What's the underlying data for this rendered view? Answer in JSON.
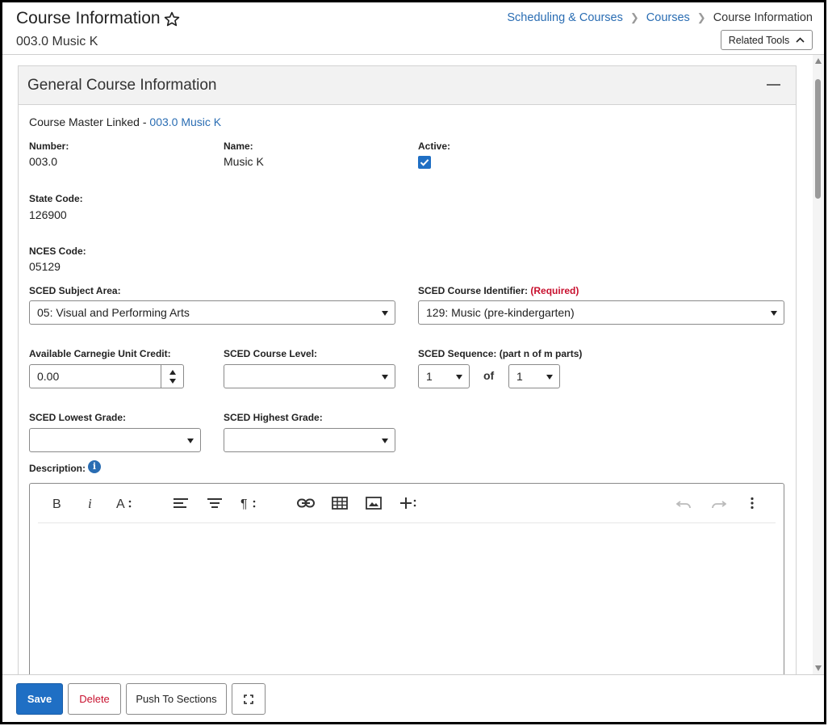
{
  "header": {
    "title": "Course Information",
    "subtitle": "003.0 Music K",
    "related_tools_label": "Related Tools"
  },
  "breadcrumb": [
    {
      "label": "Scheduling & Courses"
    },
    {
      "label": "Courses"
    },
    {
      "label": "Course Information"
    }
  ],
  "panel": {
    "title": "General Course Information",
    "master_linked_prefix": "Course Master Linked - ",
    "master_linked_link": "003.0 Music K"
  },
  "fields": {
    "number_label": "Number:",
    "number_value": "003.0",
    "name_label": "Name:",
    "name_value": "Music K",
    "active_label": "Active:",
    "active_checked": true,
    "state_code_label": "State Code:",
    "state_code_value": "126900",
    "nces_code_label": "NCES Code:",
    "nces_code_value": "05129",
    "sced_subject_label": "SCED Subject Area:",
    "sced_subject_value": "05: Visual and Performing Arts",
    "sced_course_id_label": "SCED Course Identifier:",
    "sced_course_id_required": "(Required)",
    "sced_course_id_value": "129: Music (pre-kindergarten)",
    "carnegie_label": "Available Carnegie Unit Credit:",
    "carnegie_value": "0.00",
    "course_level_label": "SCED Course Level:",
    "course_level_value": "",
    "sequence_label": "SCED Sequence: (part n of m parts)",
    "sequence_n_value": "1",
    "sequence_of": "of",
    "sequence_m_value": "1",
    "lowest_grade_label": "SCED Lowest Grade:",
    "lowest_grade_value": "",
    "highest_grade_label": "SCED Highest Grade:",
    "highest_grade_value": "",
    "description_label": "Description:"
  },
  "editor_toolbar": {
    "icons": [
      "bold-icon",
      "italic-icon",
      "font-size-icon",
      "align-left-icon",
      "align-center-icon",
      "paragraph-icon",
      "link-icon",
      "table-icon",
      "image-icon",
      "insert-more-icon",
      "undo-icon",
      "redo-icon",
      "more-options-icon"
    ]
  },
  "footer": {
    "save_label": "Save",
    "delete_label": "Delete",
    "push_label": "Push To Sections"
  },
  "colors": {
    "accent": "#1f6fc4",
    "link": "#2a6db3",
    "danger": "#c8102e"
  }
}
